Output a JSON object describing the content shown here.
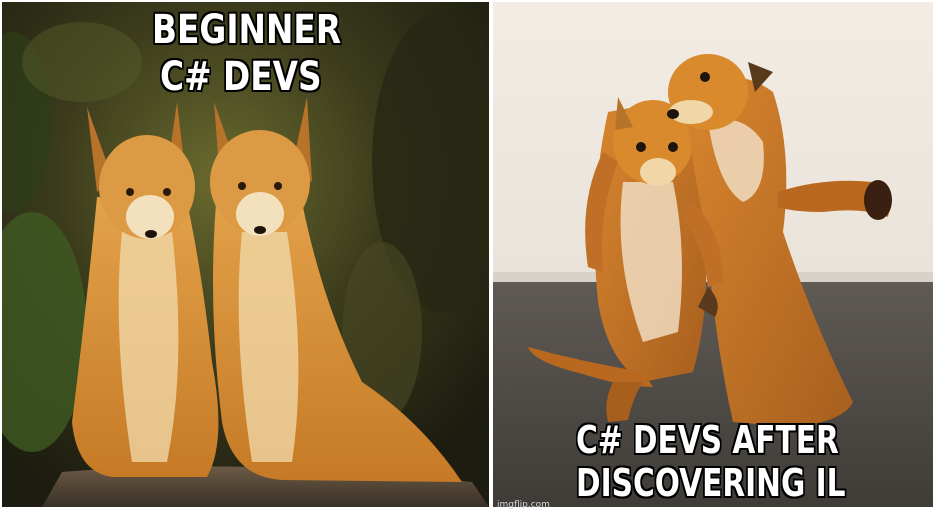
{
  "meme": {
    "top_caption": [
      "BEGINNER",
      "C# DEVS"
    ],
    "bottom_caption": [
      "C# DEVS AFTER",
      "DISCOVERING IL"
    ],
    "watermark": "imgflip.com"
  },
  "colors": {
    "fox_orange": "#d98a2c",
    "fox_light": "#f1d6a8",
    "forest_dark": "#2c2a16",
    "wall": "#ece6de",
    "floor": "#5a5550",
    "caption_text": "#ffffff",
    "caption_outline": "#000000"
  }
}
